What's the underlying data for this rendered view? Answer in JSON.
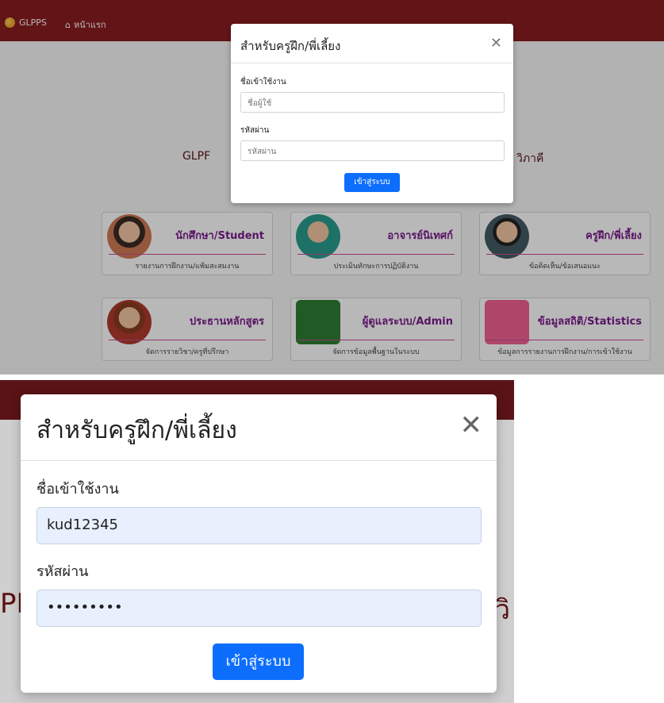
{
  "top": {
    "brand": "GLPPS",
    "home_label": "หน้าแรก",
    "bg_heading_left": "GLPF",
    "bg_heading_right": "วิภาคี",
    "modal": {
      "title": "สำหรับครูฝึก/พี่เลี้ยง",
      "username_label": "ชื่อเข้าใช้งาน",
      "username_placeholder": "ชื่อผู้ใช้",
      "password_label": "รหัสผ่าน",
      "password_placeholder": "รหัสผ่าน",
      "login_button": "เข้าสู่ระบบ"
    },
    "cards": [
      {
        "title": "นักศึกษา/Student",
        "sub": "รายงานการฝึกงาน/แฟ้มสะสมงาน"
      },
      {
        "title": "อาจารย์นิเทศก์",
        "sub": "ประเมินทักษะการปฏิบัติงาน"
      },
      {
        "title": "ครูฝึก/พี่เลี้ยง",
        "sub": "ข้อคิดเห็น/ข้อเสนอแนะ"
      },
      {
        "title": "ประธานหลักสูตร",
        "sub": "จัดการรายวิชา/ครูที่ปรึกษา"
      },
      {
        "title": "ผู้ดูแลระบบ/Admin",
        "sub": "จัดการข้อมูลพื้นฐานในระบบ"
      },
      {
        "title": "ข้อมูลสถิติ/Statistics",
        "sub": "ข้อมูลการรายงานการฝึกงาน/การเข้าใช้งาน"
      }
    ]
  },
  "bottom": {
    "bg_left": "PP",
    "bg_right": "วิ",
    "modal": {
      "title": "สำหรับครูฝึก/พี่เลี้ยง",
      "username_label": "ชื่อเข้าใช้งาน",
      "username_value": "kud12345",
      "password_label": "รหัสผ่าน",
      "password_value": "•••••••••",
      "login_button": "เข้าสู่ระบบ"
    }
  },
  "colors": {
    "navbar": "#8a1c1f",
    "primary_button": "#0d6efd",
    "card_title": "#7b1c8d"
  }
}
